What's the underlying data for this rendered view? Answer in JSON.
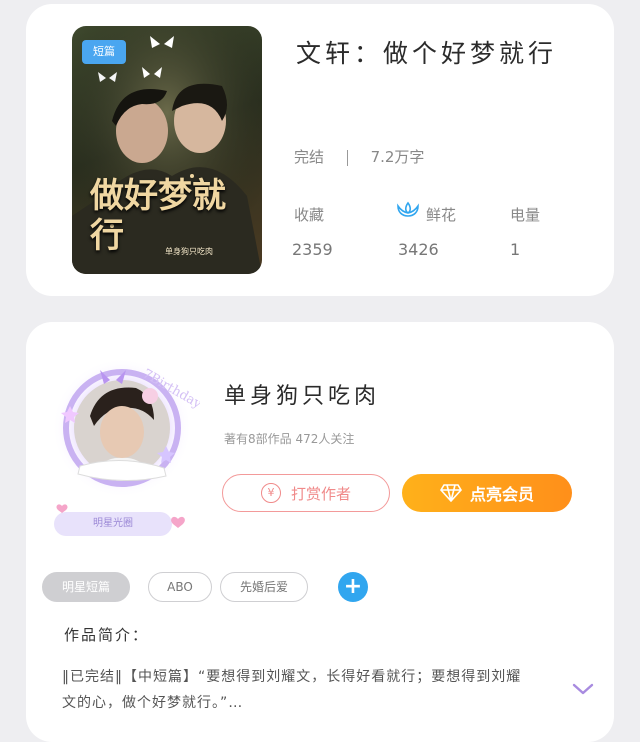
{
  "book": {
    "cover_tag": "短篇",
    "cover_title": "做好梦就行",
    "cover_subtitle": "单身狗只吃肉",
    "title": "文轩：做个好梦就行",
    "status": "完结",
    "word_count": "7.2万字",
    "stats": [
      {
        "label": "收藏",
        "value": "2359"
      },
      {
        "label": "鲜花",
        "value": "3426"
      },
      {
        "label": "电量",
        "value": "1"
      }
    ]
  },
  "author": {
    "name": "单身狗只吃肉",
    "meta": "著有8部作品 472人关注",
    "badge": "明星光圈",
    "tip_label": "打赏作者",
    "tip_icon": "¥",
    "vip_label": "点亮会员",
    "tags": [
      "明星短篇",
      "ABO",
      "先婚后爱"
    ],
    "add_tag": "+",
    "intro_title": "作品简介：",
    "intro_text": "‖已完结‖【中短篇】“要想得到刘耀文，长得好看就行；要想得到刘耀文的心，做个好梦就行。”…"
  },
  "colors": {
    "accent_orange": "#ff9f1a",
    "accent_blue": "#31a6ef",
    "tip_pink": "#f08a8a",
    "chevron_purple": "#a88be0"
  }
}
